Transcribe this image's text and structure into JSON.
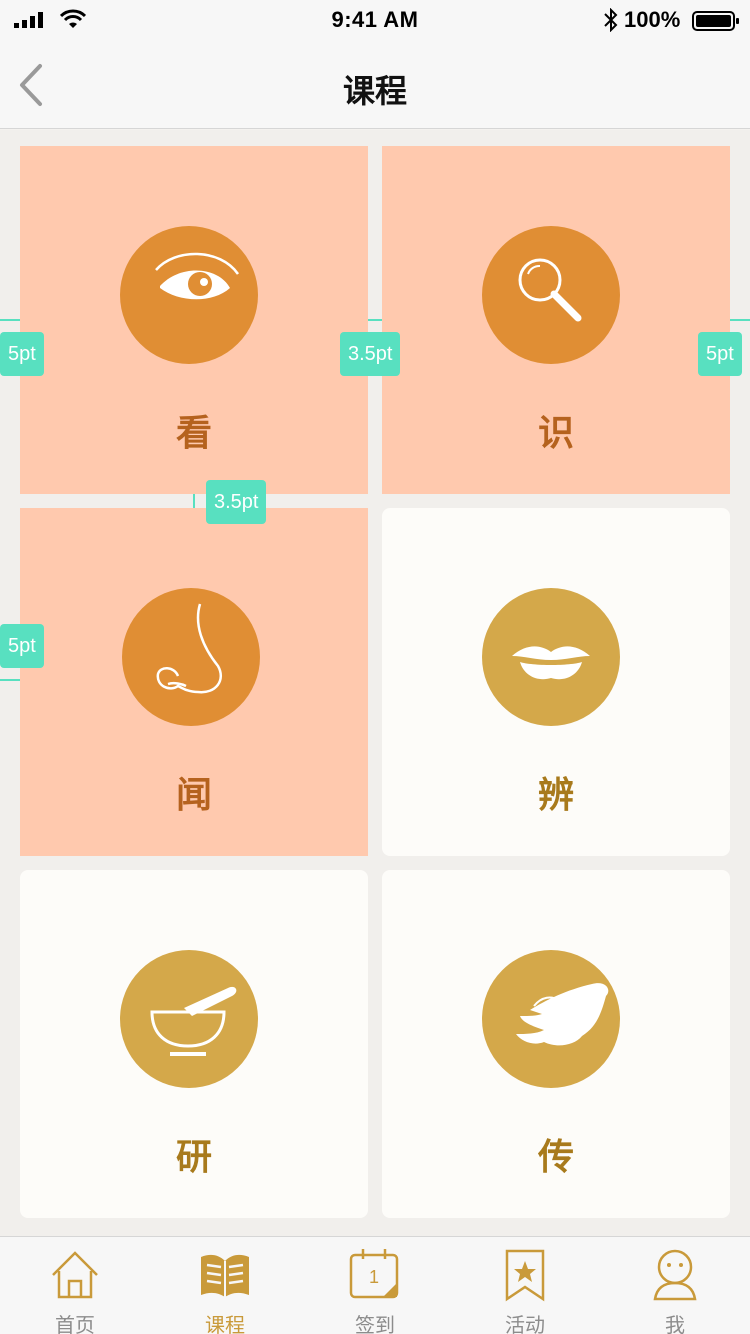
{
  "status_bar": {
    "time": "9:41 AM",
    "battery_percent": "100%"
  },
  "nav": {
    "title": "课程",
    "back_icon": "chevron-left-icon"
  },
  "tiles": [
    {
      "label": "看",
      "icon": "eye-icon",
      "highlighted": true
    },
    {
      "label": "识",
      "icon": "magnifier-icon",
      "highlighted": true
    },
    {
      "label": "闻",
      "icon": "nose-icon",
      "highlighted": true
    },
    {
      "label": "辨",
      "icon": "mouth-icon",
      "highlighted": false
    },
    {
      "label": "研",
      "icon": "mortar-pestle-icon",
      "highlighted": false
    },
    {
      "label": "传",
      "icon": "hand-icon",
      "highlighted": false
    }
  ],
  "measurements": {
    "left_margin": "5pt",
    "gap_h": "3.5pt",
    "right_margin": "5pt",
    "gap_v": "3.5pt",
    "left_margin_2": "5pt"
  },
  "tab_bar": {
    "tabs": [
      {
        "label": "首页",
        "icon": "home-icon",
        "active": false
      },
      {
        "label": "课程",
        "icon": "book-icon",
        "active": true
      },
      {
        "label": "签到",
        "icon": "calendar-icon",
        "active": false
      },
      {
        "label": "活动",
        "icon": "bookmark-star-icon",
        "active": false
      },
      {
        "label": "我",
        "icon": "person-icon",
        "active": false
      }
    ]
  },
  "colors": {
    "highlight_tile": "#ffc9ae",
    "highlight_circle": "#e08e34",
    "gold_circle": "#d4a84a",
    "measure": "#58e0c0",
    "active_tab": "#c99a3a"
  }
}
